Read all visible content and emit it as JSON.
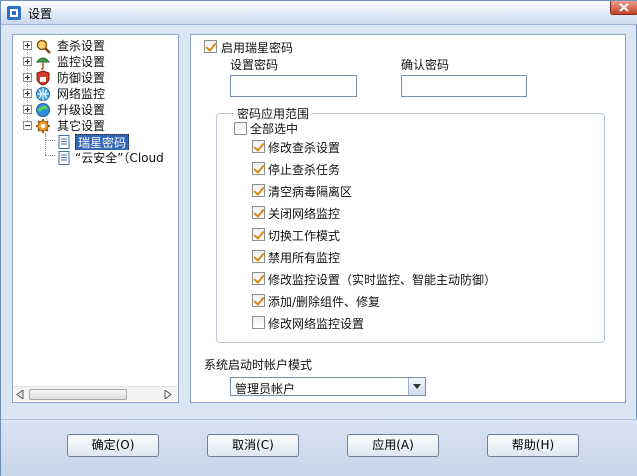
{
  "window": {
    "title": "设置"
  },
  "tree": {
    "items": [
      {
        "label": "查杀设置",
        "icon": "scan-icon"
      },
      {
        "label": "监控设置",
        "icon": "monitor-umbrella-icon"
      },
      {
        "label": "防御设置",
        "icon": "shield-icon"
      },
      {
        "label": "网络监控",
        "icon": "network-globe-icon"
      },
      {
        "label": "升级设置",
        "icon": "update-globe-icon"
      },
      {
        "label": "其它设置",
        "icon": "gear-icon"
      }
    ],
    "children": [
      {
        "label": "瑞星密码",
        "icon": "document-icon",
        "selected": true
      },
      {
        "label": "“云安全”（Cloud",
        "icon": "document-icon"
      }
    ]
  },
  "password": {
    "enable_label": "启用瑞星密码",
    "enable_checked": true,
    "set_label": "设置密码",
    "confirm_label": "确认密码",
    "set_value": "",
    "confirm_value": ""
  },
  "scope": {
    "group_title": "密码应用范围",
    "select_all_label": "全部选中",
    "select_all_checked": false,
    "options": [
      {
        "label": "修改查杀设置",
        "checked": true
      },
      {
        "label": "停止查杀任务",
        "checked": true
      },
      {
        "label": "清空病毒隔离区",
        "checked": true
      },
      {
        "label": "关闭网络监控",
        "checked": true
      },
      {
        "label": "切换工作模式",
        "checked": true
      },
      {
        "label": "禁用所有监控",
        "checked": true
      },
      {
        "label": "修改监控设置（实时监控、智能主动防御）",
        "checked": true
      },
      {
        "label": "添加/删除组件、修复",
        "checked": true
      },
      {
        "label": "修改网络监控设置",
        "checked": false
      }
    ]
  },
  "account_mode": {
    "label": "系统启动时帐户模式",
    "selected": "管理员帐户"
  },
  "buttons": {
    "ok": "确定(O)",
    "cancel": "取消(C)",
    "apply": "应用(A)",
    "help": "帮助(H)"
  },
  "colors": {
    "accent": "#3368b8",
    "check": "#d88a16",
    "frame": "#dbe6f4"
  }
}
